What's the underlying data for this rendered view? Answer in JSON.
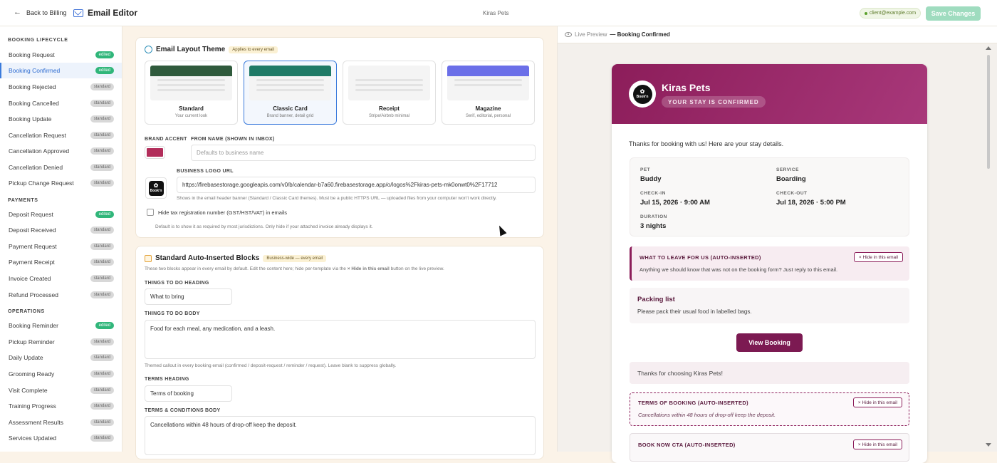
{
  "header": {
    "back_label": "Back to Billing",
    "title": "Email Editor",
    "business_name": "Kiras Pets",
    "client_email": "client@example.com",
    "save_label": "Save Changes"
  },
  "sidebar": {
    "sections": [
      {
        "title": "BOOKING LIFECYCLE",
        "items": [
          {
            "label": "Booking Request",
            "badge": "edited"
          },
          {
            "label": "Booking Confirmed",
            "badge": "edited"
          },
          {
            "label": "Booking Rejected",
            "badge": "standard"
          },
          {
            "label": "Booking Cancelled",
            "badge": "standard"
          },
          {
            "label": "Booking Update",
            "badge": "standard"
          },
          {
            "label": "Cancellation Request",
            "badge": "standard"
          },
          {
            "label": "Cancellation Approved",
            "badge": "standard"
          },
          {
            "label": "Cancellation Denied",
            "badge": "standard"
          },
          {
            "label": "Pickup Change Request",
            "badge": "standard"
          }
        ]
      },
      {
        "title": "PAYMENTS",
        "items": [
          {
            "label": "Deposit Request",
            "badge": "edited"
          },
          {
            "label": "Deposit Received",
            "badge": "standard"
          },
          {
            "label": "Payment Request",
            "badge": "standard"
          },
          {
            "label": "Payment Receipt",
            "badge": "standard"
          },
          {
            "label": "Invoice Created",
            "badge": "standard"
          },
          {
            "label": "Refund Processed",
            "badge": "standard"
          }
        ]
      },
      {
        "title": "OPERATIONS",
        "items": [
          {
            "label": "Booking Reminder",
            "badge": "edited"
          },
          {
            "label": "Pickup Reminder",
            "badge": "standard"
          },
          {
            "label": "Daily Update",
            "badge": "standard"
          },
          {
            "label": "Grooming Ready",
            "badge": "standard"
          },
          {
            "label": "Visit Complete",
            "badge": "standard"
          },
          {
            "label": "Training Progress",
            "badge": "standard"
          },
          {
            "label": "Assessment Results",
            "badge": "standard"
          },
          {
            "label": "Services Updated",
            "badge": "standard"
          }
        ]
      }
    ]
  },
  "layout_theme": {
    "title": "Email Layout Theme",
    "chip": "Applies to every email",
    "themes": [
      {
        "name": "Standard",
        "desc": "Your current look",
        "color": "#2f5a3c"
      },
      {
        "name": "Classic Card",
        "desc": "Brand banner, detail grid",
        "color": "#1f7a66"
      },
      {
        "name": "Receipt",
        "desc": "Stripe/Airbnb minimal",
        "color": "#f4f4f4"
      },
      {
        "name": "Magazine",
        "desc": "Serif, editorial, personal",
        "color": "#6b6fe8"
      }
    ],
    "brand_accent_label": "BRAND ACCENT",
    "brand_accent_color": "#b22d5a",
    "from_name_label": "FROM NAME (SHOWN IN INBOX)",
    "from_name_placeholder": "Defaults to business name",
    "logo_url_label": "BUSINESS LOGO URL",
    "logo_url_value": "https://firebasestorage.googleapis.com/v0/b/calendar-b7a60.firebasestorage.app/o/logos%2Fkiras-pets-mk0onwt0%2F17712",
    "logo_help": "Shows in the email header banner (Standard / Classic Card themes). Must be a public HTTPS URL — uploaded files from your computer won't work directly.",
    "logo_text": "Book'n",
    "hide_tax_label": "Hide tax registration number (GST/HST/VAT) in emails",
    "hide_tax_help": "Default is to show it as required by most jurisdictions. Only hide if your attached invoice already displays it."
  },
  "auto_blocks": {
    "title": "Standard Auto-Inserted Blocks",
    "chip": "Business-wide — every email",
    "intro_a": "These two blocks appear in every email by default. Edit the content here; hide per-template via the ",
    "intro_b": "× Hide in this email",
    "intro_c": " button on the live preview.",
    "todo_heading_label": "THINGS TO DO HEADING",
    "todo_heading_value": "What to bring",
    "todo_body_label": "THINGS TO DO BODY",
    "todo_body_value": "Food for each meal, any medication, and a leash.",
    "todo_help": "Themed callout in every booking email (confirmed / deposit-request / reminder / request). Leave blank to suppress globally.",
    "terms_heading_label": "TERMS HEADING",
    "terms_heading_value": "Terms of booking",
    "terms_body_label": "TERMS & CONDITIONS BODY",
    "terms_body_value": "Cancellations within 48 hours of drop-off keep the deposit."
  },
  "preview": {
    "label": "Live Preview",
    "template": "— Booking Confirmed",
    "email": {
      "business": "Kiras Pets",
      "status": "YOUR STAY IS CONFIRMED",
      "intro": "Thanks for booking with us! Here are your stay details.",
      "details": {
        "pet_label": "PET",
        "pet": "Buddy",
        "service_label": "SERVICE",
        "service": "Boarding",
        "checkin_label": "CHECK-IN",
        "checkin": "Jul 15, 2026 · 9:00 AM",
        "checkout_label": "CHECK-OUT",
        "checkout": "Jul 18, 2026 · 5:00 PM",
        "duration_label": "DURATION",
        "duration": "3 nights"
      },
      "leave_title": "WHAT TO LEAVE FOR US (AUTO-INSERTED)",
      "leave_body": "Anything we should know that was not on the booking form? Just reply to this email.",
      "hide_label": "× Hide in this email",
      "packing_title": "Packing list",
      "packing_body": "Please pack their usual food in labelled bags.",
      "view_booking": "View Booking",
      "thanks": "Thanks for choosing Kiras Pets!",
      "terms_title": "TERMS OF BOOKING (AUTO-INSERTED)",
      "terms_body": "Cancellations within 48 hours of drop-off keep the deposit.",
      "cta_title": "BOOK NOW CTA (AUTO-INSERTED)"
    }
  }
}
